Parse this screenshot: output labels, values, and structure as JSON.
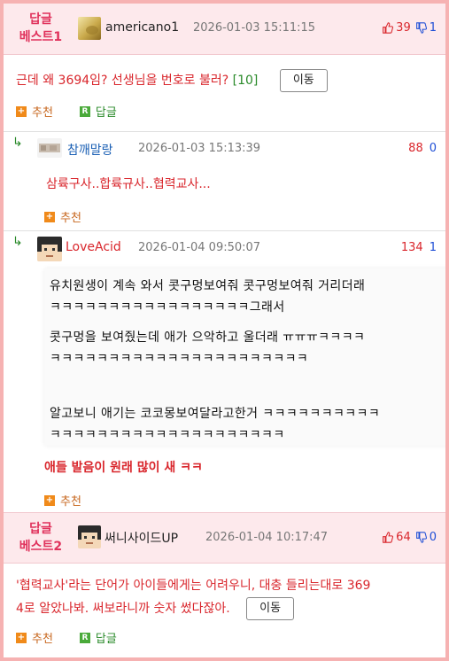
{
  "best1": {
    "badge_line1": "답글",
    "badge_line2": "베스트1",
    "nick": "americano1",
    "date": "2026-01-03 15:11:15",
    "up": "39",
    "down": "1",
    "text": "근데 왜 3694임? 선생님을 번호로 불러?",
    "ref": "[10]",
    "move_label": "이동",
    "recommend": "추천",
    "reply": "답글"
  },
  "reply1": {
    "nick": "참깨말랑",
    "date": "2026-01-03 15:13:39",
    "up": "88",
    "down": "0",
    "text": "삼륙구사..합륙규사..협력교사...",
    "recommend": "추천"
  },
  "reply2": {
    "nick": "LoveAcid",
    "date": "2026-01-04 09:50:07",
    "up": "134",
    "down": "1",
    "image_lines": [
      "유치원생이 계속 와서 콧구멍보여줘 콧구멍보여줘  거리더래",
      "ㅋㅋㅋㅋㅋㅋㅋㅋㅋㅋㅋㅋㅋㅋㅋㅋㅋ그래서",
      "콧구멍을 보여줬는데 애가 으악하고 울더래 ㅠㅠㅠㅋㅋㅋㅋ",
      "ㅋㅋㅋㅋㅋㅋㅋㅋㅋㅋㅋㅋㅋㅋㅋㅋㅋㅋㅋㅋㅋㅋ",
      "알고보니 애기는 코코몽보여달라고한거 ㅋㅋㅋㅋㅋㅋㅋㅋㅋㅋ",
      "ㅋㅋㅋㅋㅋㅋㅋㅋㅋㅋㅋㅋㅋㅋㅋㅋㅋㅋㅋㅋ"
    ],
    "text": "애들 발음이 원래 많이 새 ㅋㅋ",
    "recommend": "추천"
  },
  "best2": {
    "badge_line1": "답글",
    "badge_line2": "베스트2",
    "nick": "써니사이드UP",
    "date": "2026-01-04 10:17:47",
    "up": "64",
    "down": "0",
    "text_line1": "'협력교사'라는 단어가 아이들에게는 어려우니, 대충 들리는대로 369",
    "text_line2": "4로 알았나봐. 써보라니까 숫자 썼다잖아.",
    "move_label": "이동",
    "recommend": "추천",
    "reply": "답글"
  },
  "colors": {
    "best_red": "#e0325c",
    "up_red": "#d9262c",
    "down_blue": "#1f4fd6",
    "recommend_orange": "#f08a1a",
    "reply_green": "#4aaa3a"
  },
  "icons": {
    "up": "thumbs-up-icon",
    "down": "thumbs-down-icon",
    "recommend": "plus-box-icon",
    "reply": "r-box-icon",
    "reply_arrow": "reply-arrow-icon"
  }
}
